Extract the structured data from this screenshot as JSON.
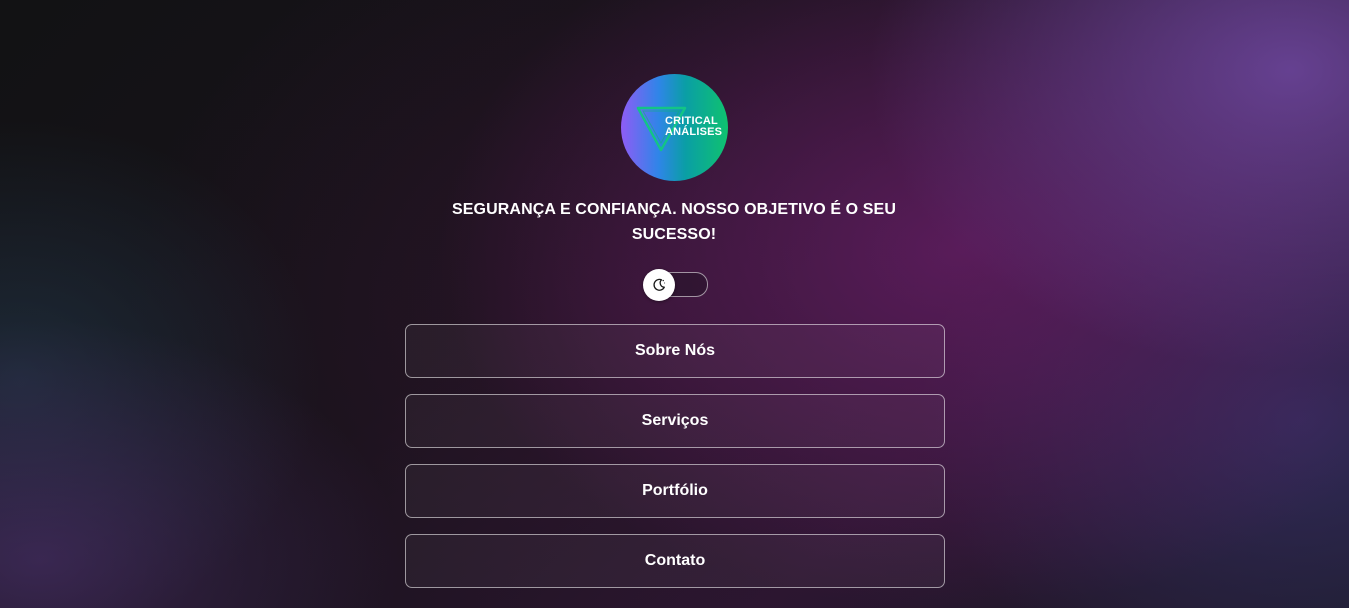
{
  "logo": {
    "line1": "CRITICAL",
    "line2": "ANÁLISES",
    "icon": "triangle-logo-icon"
  },
  "tagline": "SEGURANÇA E CONFIANÇA. NOSSO OBJETIVO É O SEU SUCESSO!",
  "theme_toggle": {
    "icon": "moon-icon",
    "state": "dark"
  },
  "nav": {
    "about": "Sobre Nós",
    "services": "Serviços",
    "portfolio": "Portfólio",
    "contact": "Contato"
  },
  "colors": {
    "logo_gradient_start": "#8f5cf5",
    "logo_gradient_end": "#0fc26f",
    "background_accent": "#6e48a0",
    "text": "#ffffff"
  }
}
